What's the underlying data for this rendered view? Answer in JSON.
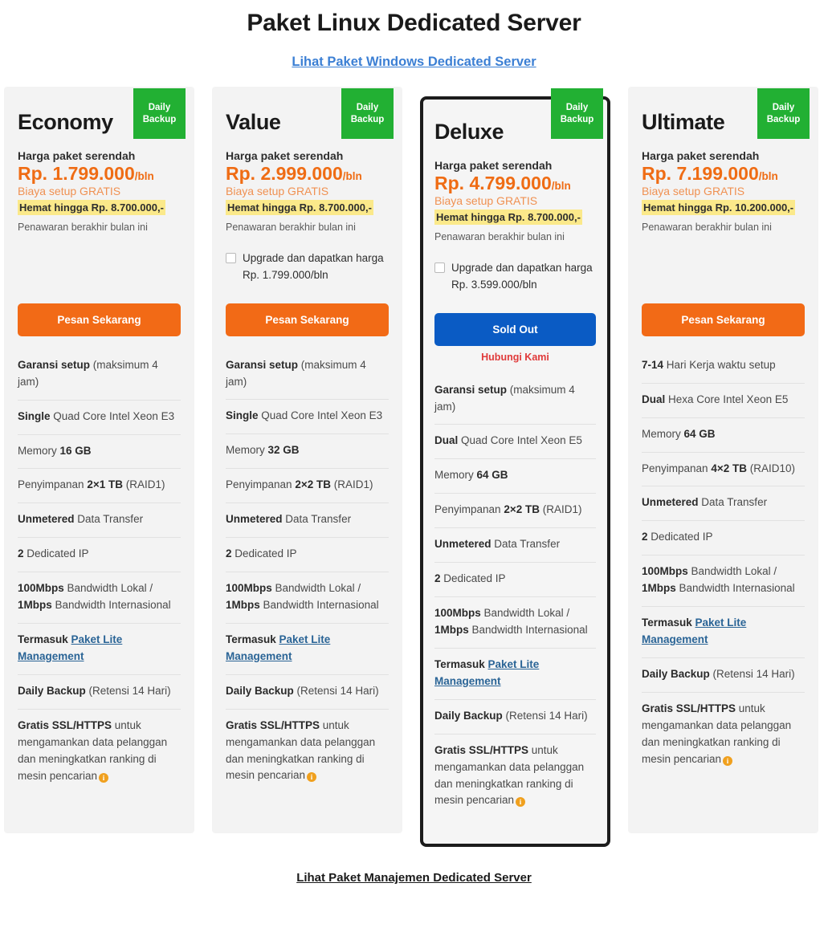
{
  "header": {
    "title": "Paket Linux Dedicated Server",
    "subtitle_link": "Lihat Paket Windows Dedicated Server"
  },
  "labels": {
    "price_label": "Harga paket serendah",
    "setup_free": "Biaya setup GRATIS",
    "offer_note": "Penawaran berakhir bulan ini",
    "badge_line1": "Daily",
    "badge_line2": "Backup",
    "order_button": "Pesan Sekarang",
    "soldout_button": "Sold Out",
    "contact_link": "Hubungi Kami",
    "info_icon": "i"
  },
  "colors": {
    "accent_orange": "#f26a16",
    "price_orange": "#ef6c14",
    "badge_green": "#22b033",
    "soldout_blue": "#0a5bc4",
    "contact_red": "#e03a3a",
    "highlight_yellow": "#fbe98a",
    "link_blue": "#3b7fd4",
    "featured_border": "#1c1c1c",
    "card_bg": "#f3f3f3"
  },
  "plans": [
    {
      "id": "economy",
      "name": "Economy",
      "price": "Rp. 1.799.000",
      "per": "/bln",
      "savings": "Hemat hingga Rp. 8.700.000,-",
      "featured": false,
      "has_upgrade": false,
      "upgrade_text": "",
      "cta_label": "Pesan Sekarang",
      "cta_type": "order",
      "features": [
        {
          "bold": "Garansi setup",
          "rest": " (maksimum 4 jam)"
        },
        {
          "bold": "Single",
          "rest": " Quad Core Intel Xeon E3"
        },
        {
          "bold": "",
          "rest": "Memory ",
          "bold2": "16 GB",
          "rest2": ""
        },
        {
          "bold": "",
          "rest": "Penyimpanan ",
          "bold2": "2×1 TB",
          "rest2": " (RAID1)"
        },
        {
          "bold": "Unmetered",
          "rest": " Data Transfer"
        },
        {
          "bold": "2",
          "rest": " Dedicated IP"
        },
        {
          "bold": "100Mbps",
          "rest": " Bandwidth Lokal / ",
          "bold2": "1Mbps",
          "rest2": " Bandwidth Internasional"
        },
        {
          "bold": "Termasuk ",
          "link": "Paket Lite Management",
          "rest": ""
        },
        {
          "bold": "Daily Backup",
          "rest": " (Retensi 14 Hari)"
        },
        {
          "bold": "Gratis SSL/HTTPS",
          "rest": " untuk mengamankan data pelanggan dan meningkatkan ranking di mesin pencarian",
          "info": true
        }
      ]
    },
    {
      "id": "value",
      "name": "Value",
      "price": "Rp. 2.999.000",
      "per": "/bln",
      "savings": "Hemat hingga Rp. 8.700.000,-",
      "featured": false,
      "has_upgrade": true,
      "upgrade_text": "Upgrade dan dapatkan harga Rp. 1.799.000/bln",
      "cta_label": "Pesan Sekarang",
      "cta_type": "order",
      "features": [
        {
          "bold": "Garansi setup",
          "rest": " (maksimum 4 jam)"
        },
        {
          "bold": "Single",
          "rest": " Quad Core Intel Xeon E3"
        },
        {
          "bold": "",
          "rest": "Memory ",
          "bold2": "32 GB",
          "rest2": ""
        },
        {
          "bold": "",
          "rest": "Penyimpanan ",
          "bold2": "2×2 TB",
          "rest2": " (RAID1)"
        },
        {
          "bold": "Unmetered",
          "rest": " Data Transfer"
        },
        {
          "bold": "2",
          "rest": " Dedicated IP"
        },
        {
          "bold": "100Mbps",
          "rest": " Bandwidth Lokal / ",
          "bold2": "1Mbps",
          "rest2": " Bandwidth Internasional"
        },
        {
          "bold": "Termasuk ",
          "link": "Paket Lite Management",
          "rest": ""
        },
        {
          "bold": "Daily Backup",
          "rest": " (Retensi 14 Hari)"
        },
        {
          "bold": "Gratis SSL/HTTPS",
          "rest": " untuk mengamankan data pelanggan dan meningkatkan ranking di mesin pencarian",
          "info": true
        }
      ]
    },
    {
      "id": "deluxe",
      "name": "Deluxe",
      "price": "Rp. 4.799.000",
      "per": "/bln",
      "savings": "Hemat hingga Rp. 8.700.000,-",
      "featured": true,
      "has_upgrade": true,
      "upgrade_text": "Upgrade dan dapatkan harga Rp. 3.599.000/bln",
      "cta_label": "Sold Out",
      "cta_type": "soldout",
      "contact_label": "Hubungi Kami",
      "features": [
        {
          "bold": "Garansi setup",
          "rest": " (maksimum 4 jam)"
        },
        {
          "bold": "Dual",
          "rest": " Quad Core Intel Xeon E5"
        },
        {
          "bold": "",
          "rest": "Memory ",
          "bold2": "64 GB",
          "rest2": ""
        },
        {
          "bold": "",
          "rest": "Penyimpanan ",
          "bold2": "2×2 TB",
          "rest2": " (RAID1)"
        },
        {
          "bold": "Unmetered",
          "rest": " Data Transfer"
        },
        {
          "bold": "2",
          "rest": " Dedicated IP"
        },
        {
          "bold": "100Mbps",
          "rest": " Bandwidth Lokal / ",
          "bold2": "1Mbps",
          "rest2": " Bandwidth Internasional"
        },
        {
          "bold": "Termasuk ",
          "link": "Paket Lite Management",
          "rest": ""
        },
        {
          "bold": "Daily Backup",
          "rest": " (Retensi 14 Hari)"
        },
        {
          "bold": "Gratis SSL/HTTPS",
          "rest": " untuk mengamankan data pelanggan dan meningkatkan ranking di mesin pencarian",
          "info": true
        }
      ]
    },
    {
      "id": "ultimate",
      "name": "Ultimate",
      "price": "Rp. 7.199.000",
      "per": "/bln",
      "savings": "Hemat hingga Rp. 10.200.000,-",
      "featured": false,
      "has_upgrade": false,
      "upgrade_text": "",
      "cta_label": "Pesan Sekarang",
      "cta_type": "order",
      "features": [
        {
          "bold": "7-14",
          "rest": " Hari Kerja waktu setup"
        },
        {
          "bold": "Dual",
          "rest": " Hexa Core Intel Xeon E5"
        },
        {
          "bold": "",
          "rest": "Memory ",
          "bold2": "64 GB",
          "rest2": ""
        },
        {
          "bold": "",
          "rest": "Penyimpanan ",
          "bold2": "4×2 TB",
          "rest2": " (RAID10)"
        },
        {
          "bold": "Unmetered",
          "rest": " Data Transfer"
        },
        {
          "bold": "2",
          "rest": " Dedicated IP"
        },
        {
          "bold": "100Mbps",
          "rest": " Bandwidth Lokal / ",
          "bold2": "1Mbps",
          "rest2": " Bandwidth Internasional"
        },
        {
          "bold": "Termasuk ",
          "link": "Paket Lite Management",
          "rest": ""
        },
        {
          "bold": "Daily Backup",
          "rest": " (Retensi 14 Hari)"
        },
        {
          "bold": "Gratis SSL/HTTPS",
          "rest": " untuk mengamankan data pelanggan dan meningkatkan ranking di mesin pencarian",
          "info": true
        }
      ]
    }
  ],
  "footer": {
    "link": "Lihat Paket Manajemen Dedicated Server"
  }
}
